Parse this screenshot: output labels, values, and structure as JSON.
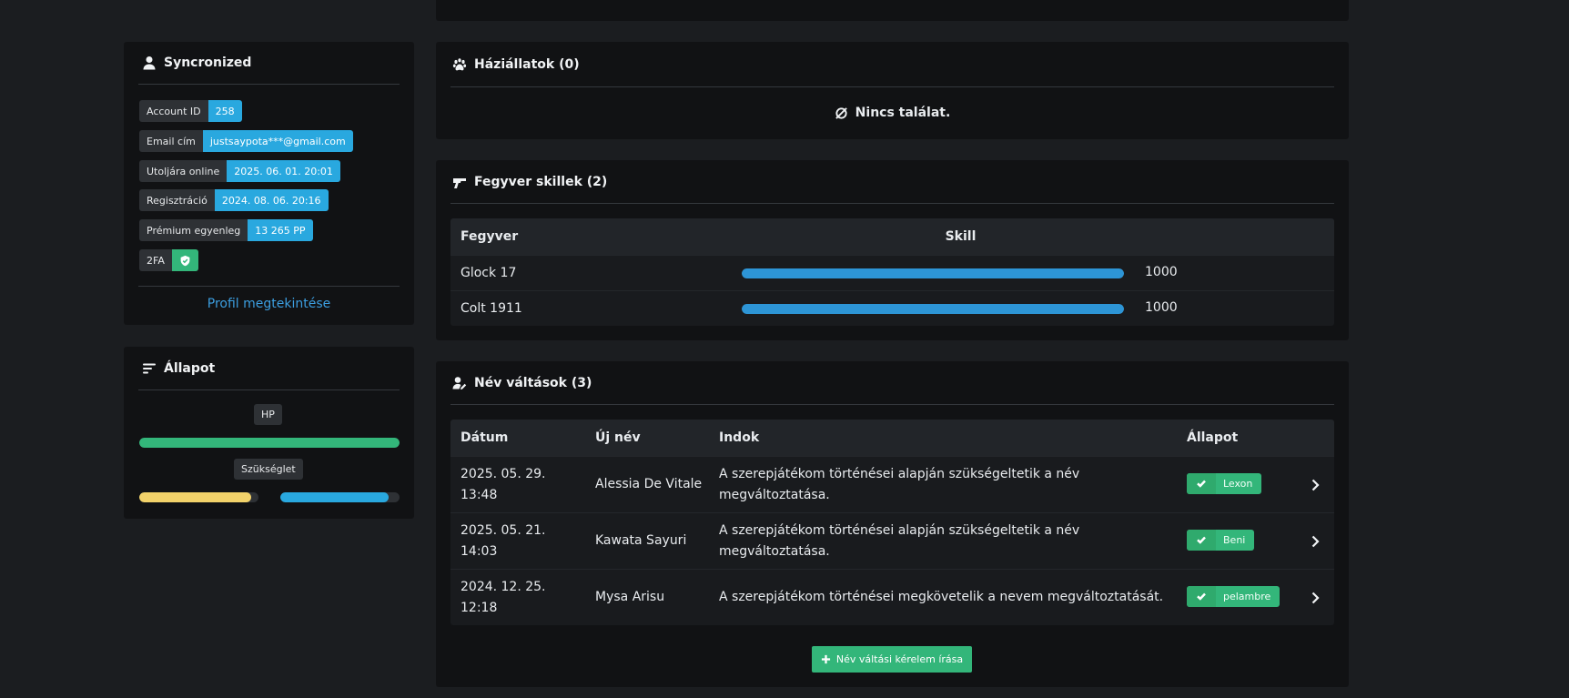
{
  "account": {
    "title": "Syncronized",
    "rows": [
      {
        "label": "Account ID",
        "value": "258"
      },
      {
        "label": "Email cím",
        "value": "justsaypota***@gmail.com"
      },
      {
        "label": "Utoljára online",
        "value": "2025. 06. 01. 20:01"
      },
      {
        "label": "Regisztráció",
        "value": "2024. 08. 06. 20:16"
      },
      {
        "label": "Prémium egyenleg",
        "value": "13 265 PP"
      },
      {
        "label": "2FA",
        "value_icon": "shield-check-icon"
      }
    ],
    "profile_link": "Profil megtekintése"
  },
  "status": {
    "title": "Állapot",
    "hp_label": "HP",
    "hp_fraction": 1.0,
    "needs_label": "Szükséglet",
    "needs": [
      {
        "fraction": 0.94,
        "color": "#f2d26a"
      },
      {
        "fraction": 0.91,
        "color": "#29a8df"
      }
    ],
    "hp_color": "#33b67a"
  },
  "pets": {
    "title": "Háziállatok (0)",
    "empty": "Nincs találat."
  },
  "weapons": {
    "title": "Fegyver skillek (2)",
    "columns": [
      "Fegyver",
      "Skill"
    ],
    "rows": [
      {
        "name": "Glock 17",
        "skill": "1000",
        "fraction": 1.0
      },
      {
        "name": "Colt 1911",
        "skill": "1000",
        "fraction": 1.0
      }
    ]
  },
  "name_changes": {
    "title": "Név váltások (3)",
    "columns": [
      "Dátum",
      "Új név",
      "Indok",
      "Állapot"
    ],
    "rows": [
      {
        "date": "2025. 05. 29. 13:48",
        "name": "Alessia De Vitale",
        "reason": "A szerepjátékom történései alapján szükségeltetik a név megváltoztatása.",
        "approver": "Lexon"
      },
      {
        "date": "2025. 05. 21. 14:03",
        "name": "Kawata Sayuri",
        "reason": "A szerepjátékom történései alapján szükségeltetik a név megváltoztatása.",
        "approver": "Beni"
      },
      {
        "date": "2024. 12. 25. 12:18",
        "name": "Mysa Arisu",
        "reason": "A szerepjátékom történései megkövetelik a nevem megváltoztatását.",
        "approver": "pelambre"
      }
    ],
    "new_button": "Név váltási kérelem írása"
  }
}
